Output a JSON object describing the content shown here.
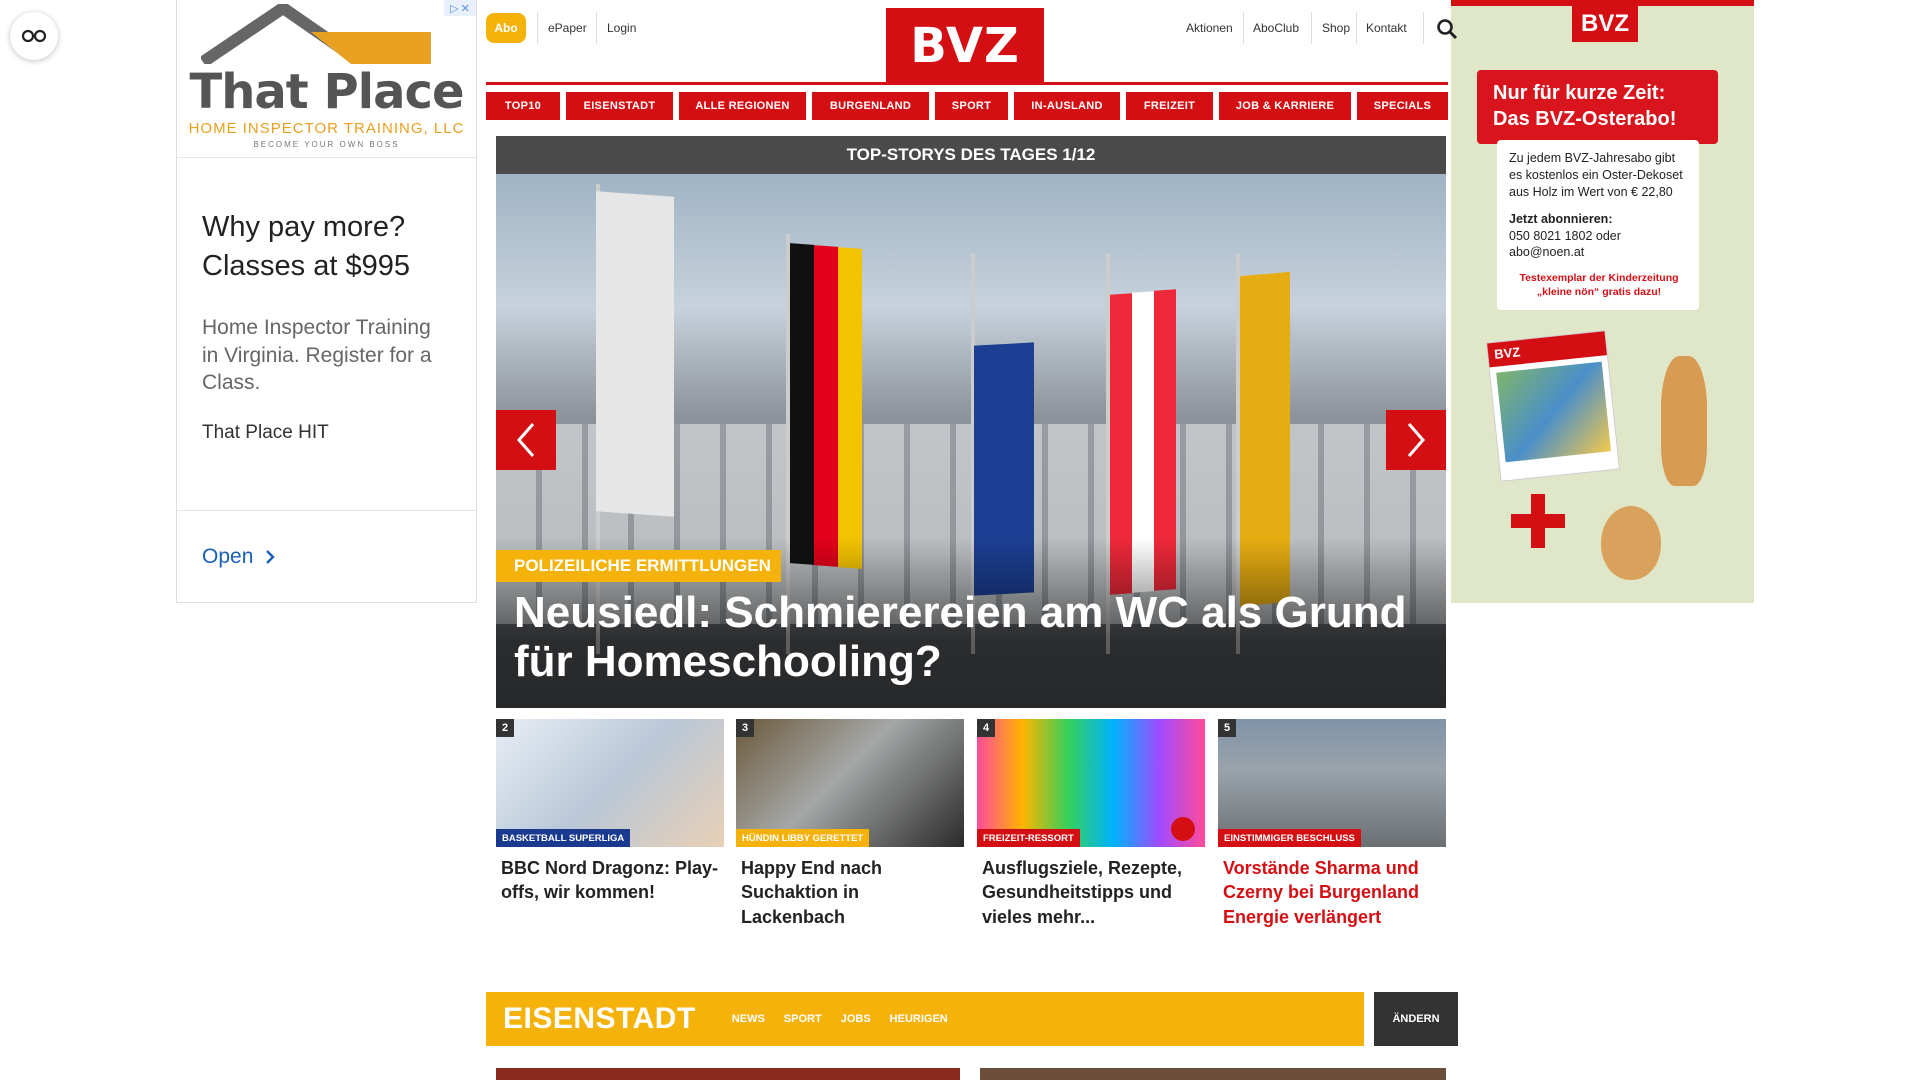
{
  "header": {
    "abo": "Abo",
    "epaper": "ePaper",
    "login": "Login",
    "logo": "BVZ",
    "right_links": [
      "Aktionen",
      "AboClub",
      "Shop",
      "Kontakt"
    ]
  },
  "nav": [
    "TOP10",
    "EISENSTADT",
    "ALLE REGIONEN",
    "BURGENLAND",
    "SPORT",
    "IN-AUSLAND",
    "FREIZEIT",
    "JOB & KARRIERE",
    "SPECIALS"
  ],
  "hero": {
    "title": "TOP-STORYS DES TAGES 1/12",
    "kicker": "POLIZEILICHE ERMITTLUNGEN",
    "headline": "Neusiedl: Schmierereien am WC als Grund für Homeschooling?"
  },
  "teasers": [
    {
      "num": "2",
      "kicker": "BASKETBALL SUPERLIGA",
      "title": "BBC Nord Dragonz: Play-offs, wir kommen!",
      "kicker_color": "#1a3a8f"
    },
    {
      "num": "3",
      "kicker": "HÜNDIN LIBBY GERETTET",
      "title": "Happy End nach Suchaktion in Lackenbach",
      "kicker_color": "#f5b20a"
    },
    {
      "num": "4",
      "kicker": "FREIZEIT-RESSORT",
      "title": "Ausflugsziele, Rezepte, Gesundheitstipps und vieles mehr...",
      "kicker_color": "#d40f14"
    },
    {
      "num": "5",
      "kicker": "EINSTIMMIGER BESCHLUSS",
      "title": "Vorstände Sharma und Czerny bei Burgenland Energie verlängert",
      "kicker_color": "#d40f14"
    }
  ],
  "section": {
    "title": "EISENSTADT",
    "links": [
      "NEWS",
      "SPORT",
      "JOBS",
      "HEURIGEN"
    ],
    "change": "ÄNDERN"
  },
  "ad_left": {
    "brand_a": "That",
    "brand_b": "Place",
    "sub": "HOME INSPECTOR TRAINING, LLC",
    "tag": "BECOME YOUR OWN BOSS",
    "headline": "Why pay more? Classes at $995",
    "desc": "Home Inspector Training in Virginia. Register for a Class.",
    "advertiser": "That Place HIT",
    "cta": "Open"
  },
  "ad_right": {
    "logo": "BVZ",
    "banner": "Nur für kurze Zeit: Das BVZ-Osterabo!",
    "text": "Zu jedem BVZ-Jahresabo gibt es kostenlos ein Oster-Dekoset aus Holz im Wert von € 22,80",
    "cta_label": "Jetzt abonnieren:",
    "contact": "050 8021 1802 oder abo@noen.at",
    "note": "Testexemplar der Kinderzeitung „kleine nön“ gratis dazu!",
    "mag_label": "BVZ"
  },
  "colors": {
    "brand_red": "#d40f14",
    "accent_yellow": "#f5b20a",
    "dark": "#4a4a4a"
  }
}
